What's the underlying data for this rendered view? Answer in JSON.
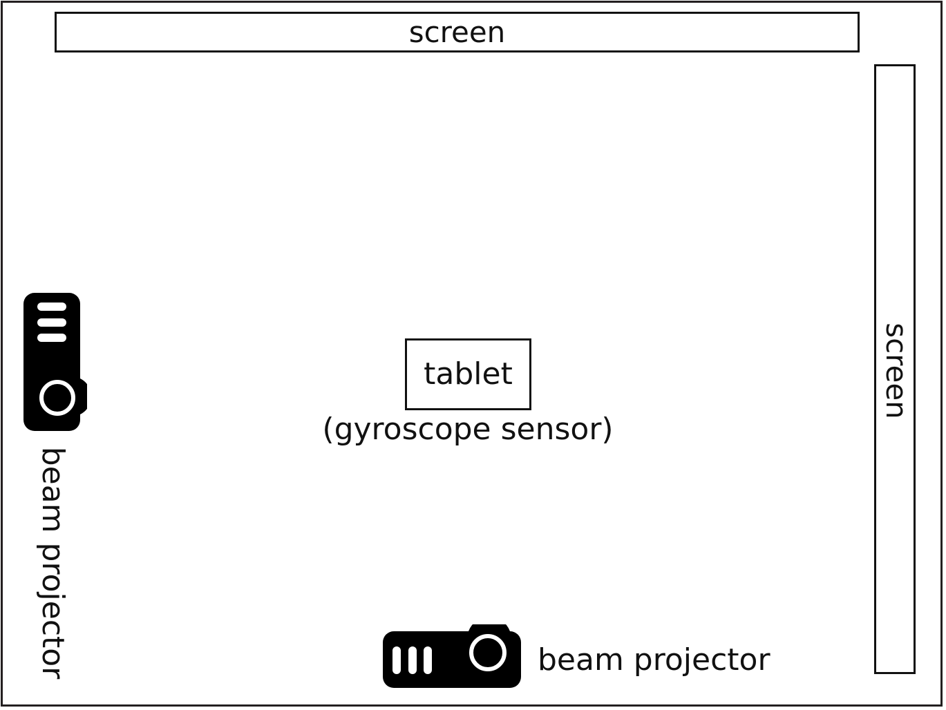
{
  "screen_top": {
    "label": "screen"
  },
  "screen_right": {
    "label": "screen"
  },
  "tablet": {
    "label": "tablet",
    "sublabel": "(gyroscope sensor)"
  },
  "projector_left": {
    "label": "beam projector",
    "icon": "projector-icon"
  },
  "projector_bottom": {
    "label": "beam projector",
    "icon": "projector-icon"
  }
}
